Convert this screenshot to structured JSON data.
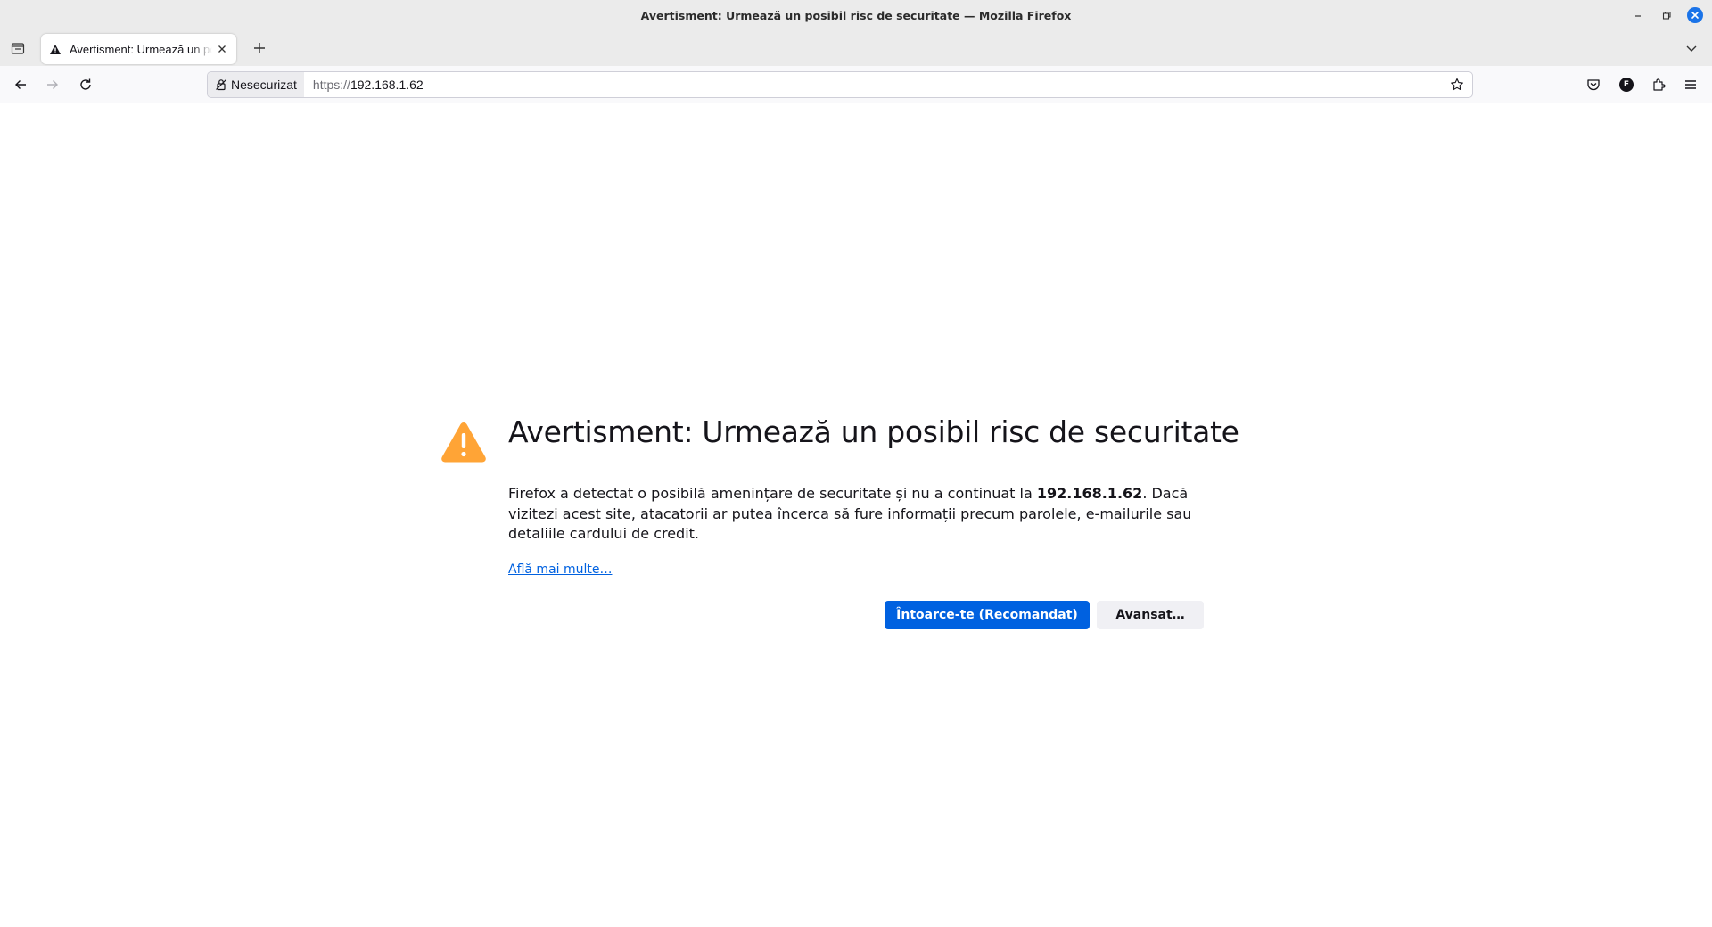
{
  "window": {
    "title": "Avertisment: Urmează un posibil risc de securitate — Mozilla Firefox"
  },
  "tabs": [
    {
      "label": "Avertisment: Urmează un posibil risc de securitate",
      "icon": "warning-icon",
      "active": true
    }
  ],
  "navbar": {
    "identity_label": "Nesecurizat",
    "url_scheme": "https://",
    "url_host": "192.168.1.62",
    "account_initial": "F"
  },
  "error_page": {
    "title": "Avertisment: Urmează un posibil risc de securitate",
    "desc_before": "Firefox a detectat o posibilă amenințare de securitate și nu a continuat la ",
    "desc_host": "192.168.1.62",
    "desc_after": ". Dacă vizitezi acest site, atacatorii ar putea încerca să fure informații precum parolele, e-mailurile sau detaliile cardului de credit.",
    "learn_more": "Află mai multe…",
    "go_back_label": "Întoarce-te (Recomandat)",
    "advanced_label": "Avansat…"
  },
  "colors": {
    "accent": "#0061e0",
    "warning": "#ffa436",
    "chrome": "#ebebeb"
  }
}
